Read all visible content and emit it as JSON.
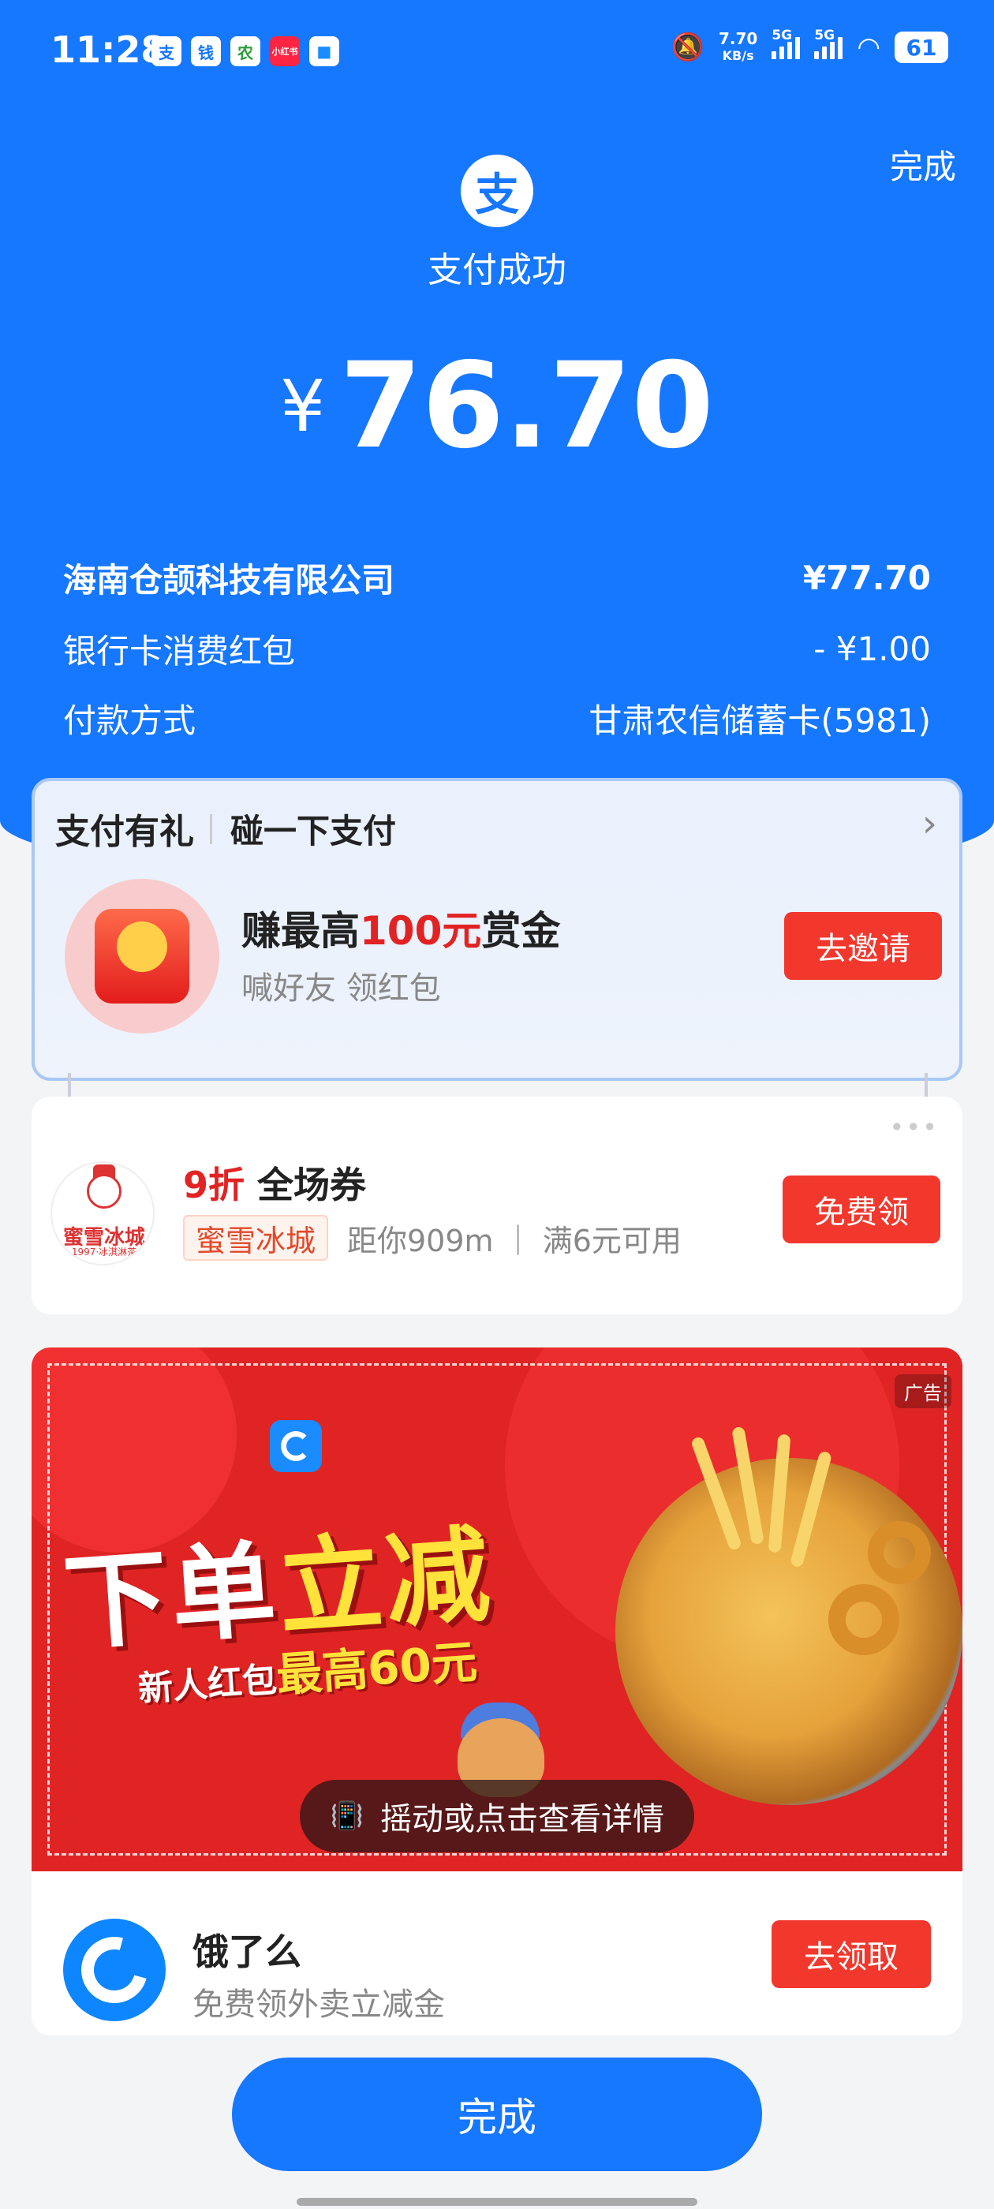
{
  "status_bar": {
    "time": "11:28",
    "apps": [
      "支",
      "钱",
      "农",
      "小红书",
      "■"
    ],
    "net_speed_value": "7.70",
    "net_speed_unit": "KB/s",
    "signal1_label": "5G",
    "signal2_label": "5G",
    "battery": "61"
  },
  "header": {
    "done_label": "完成",
    "logo_char": "支",
    "status_text": "支付成功",
    "currency_symbol": "¥",
    "amount": "76.70"
  },
  "details": [
    {
      "label": "海南仓颉科技有限公司",
      "value": "¥77.70"
    },
    {
      "label": "银行卡消费红包",
      "value": "- ¥1.00"
    },
    {
      "label": "付款方式",
      "value": "甘肃农信储蓄卡(5981)"
    }
  ],
  "gift_card": {
    "title": "支付有礼",
    "subtitle": "碰一下支付",
    "main_prefix": "赚最高",
    "main_highlight": "100元",
    "main_suffix": "赏金",
    "description": "喊好友 领红包",
    "button": "去邀请"
  },
  "coupon_card": {
    "logo_text": "蜜雪冰城",
    "logo_subtext": "1997·冰淇淋茶",
    "discount": "9折",
    "title": "全场券",
    "brand_tag": "蜜雪冰城",
    "info": "距你909m ｜ 满6元可用",
    "button": "免费领"
  },
  "ad_card": {
    "ad_label": "广告",
    "headline_white": "下单",
    "headline_yellow": "立减",
    "sub_white": "新人红包",
    "sub_yellow": "最高60元",
    "cta": "摇动或点击查看详情",
    "name": "饿了么",
    "description": "免费领外卖立减金",
    "button": "去领取"
  },
  "footer": {
    "done_button": "完成"
  },
  "colors": {
    "primary_blue": "#1677ff",
    "accent_red": "#f2372c",
    "highlight_red": "#e22323"
  }
}
